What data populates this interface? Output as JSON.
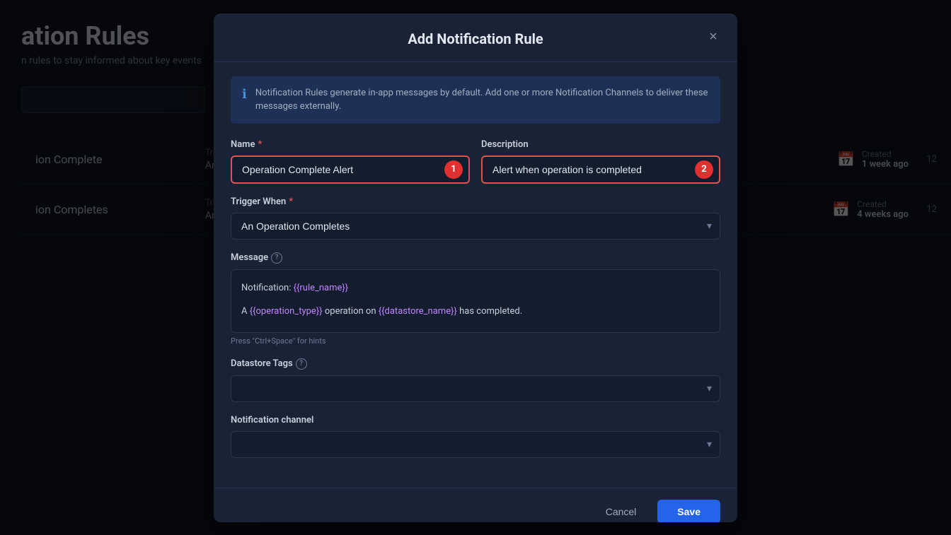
{
  "background": {
    "title": "ation Rules",
    "subtitle": "n rules to stay informed about key events",
    "rows": [
      {
        "name": "ion Complete",
        "trigger_label": "Trigger When",
        "trigger_value": "An Operation",
        "created_label": "Created",
        "created_value": "1 week ago",
        "page_num": "12"
      },
      {
        "name": "ion Completes",
        "trigger_label": "Trigger When",
        "trigger_value": "An Operation",
        "created_label": "Created",
        "created_value": "4 weeks ago",
        "page_num": "12"
      }
    ]
  },
  "modal": {
    "title": "Add Notification Rule",
    "close_label": "×",
    "info_text": "Notification Rules generate in-app messages by default. Add one or more Notification Channels to deliver these messages externally.",
    "name_label": "Name",
    "name_required": true,
    "name_value": "Operation Complete Alert",
    "name_step": "1",
    "description_label": "Description",
    "description_value": "Alert when operation is completed",
    "description_step": "2",
    "trigger_label": "Trigger When",
    "trigger_required": true,
    "trigger_value": "An Operation Completes",
    "trigger_options": [
      "An Operation Completes"
    ],
    "message_label": "Message",
    "message_hint": "Press \"Ctrl+Space\" for hints",
    "message_line1_prefix": "Notification: ",
    "message_line1_var": "{{rule_name}}",
    "message_line2_prefix": "A ",
    "message_line2_var1": "{{operation_type}}",
    "message_line2_mid": " operation on ",
    "message_line2_var2": "{{datastore_name}}",
    "message_line2_suffix": " has completed.",
    "datastore_tags_label": "Datastore Tags",
    "datastore_tags_value": "",
    "notification_channel_label": "Notification channel",
    "notification_channel_value": "",
    "cancel_label": "Cancel",
    "save_label": "Save"
  }
}
